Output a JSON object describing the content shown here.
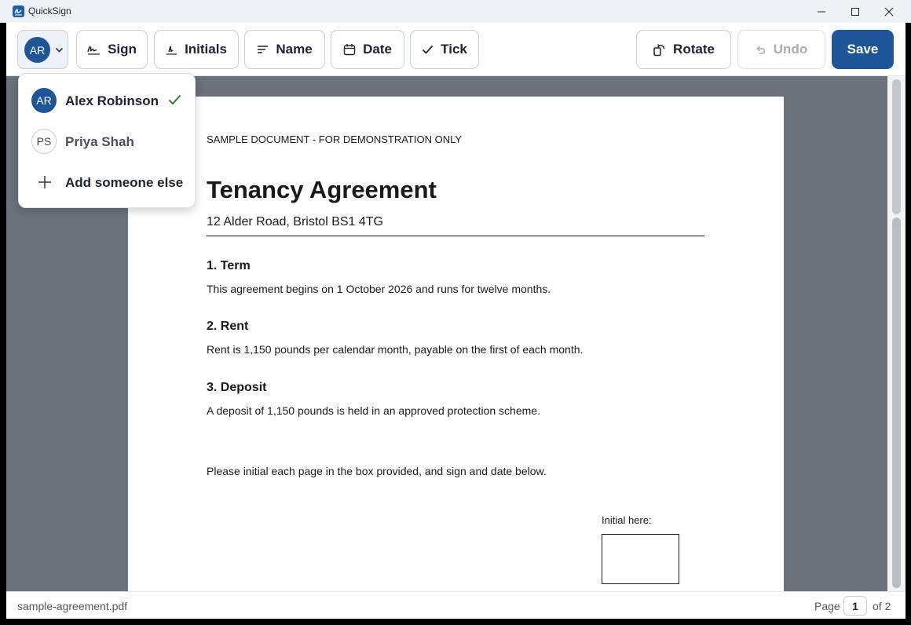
{
  "window": {
    "title": "QuickSign"
  },
  "toolbar": {
    "current_user_initials": "AR",
    "sign_label": "Sign",
    "initials_label": "Initials",
    "name_label": "Name",
    "date_label": "Date",
    "tick_label": "Tick",
    "rotate_label": "Rotate",
    "undo_label": "Undo",
    "save_label": "Save"
  },
  "user_menu": {
    "items": [
      {
        "initials": "AR",
        "name": "Alex Robinson",
        "selected": true
      },
      {
        "initials": "PS",
        "name": "Priya Shah",
        "selected": false
      }
    ],
    "add_label": "Add someone else"
  },
  "document": {
    "header_note": "SAMPLE DOCUMENT - FOR DEMONSTRATION ONLY",
    "title": "Tenancy Agreement",
    "address": "12 Alder Road, Bristol BS1 4TG",
    "sections": [
      {
        "heading": "1.  Term",
        "body": "This agreement begins on 1 October 2026 and runs for twelve months."
      },
      {
        "heading": "2.  Rent",
        "body": "Rent is 1,150 pounds per calendar month, payable on the first of each month."
      },
      {
        "heading": "3.  Deposit",
        "body": "A deposit of 1,150 pounds is held in an approved protection scheme."
      }
    ],
    "instruction": "Please initial each page in the box provided, and sign and date below.",
    "initial_label": "Initial here:"
  },
  "status": {
    "filename": "sample-agreement.pdf",
    "page_label": "Page",
    "page_current": "1",
    "page_total": "of 2"
  },
  "colors": {
    "accent": "#1d5597",
    "check": "#2e7d32",
    "viewer_bg": "#6d717b"
  }
}
